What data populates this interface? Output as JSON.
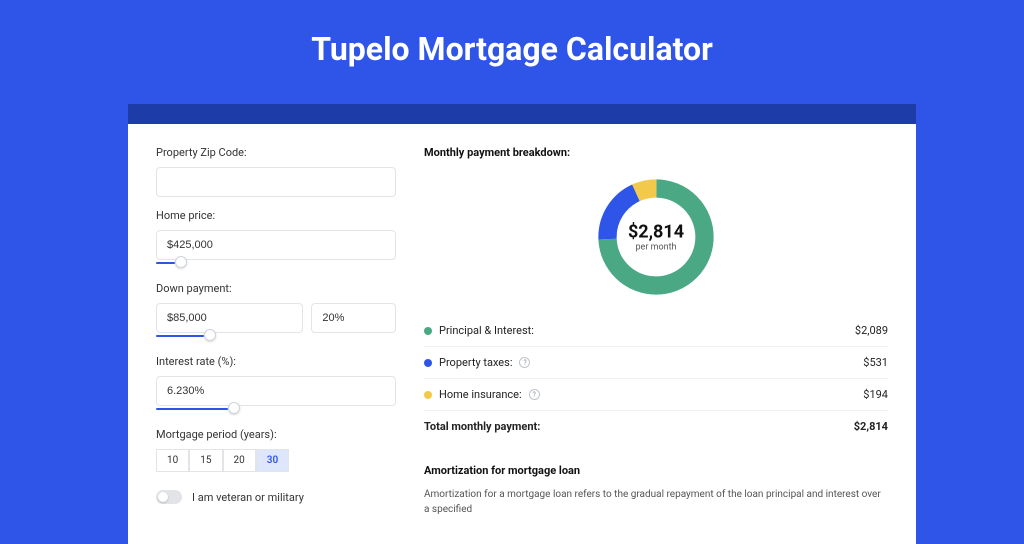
{
  "title": "Tupelo Mortgage Calculator",
  "form": {
    "zip_label": "Property Zip Code:",
    "zip_value": "",
    "price_label": "Home price:",
    "price_value": "$425,000",
    "down_label": "Down payment:",
    "down_amount": "$85,000",
    "down_pct": "20%",
    "rate_label": "Interest rate (%):",
    "rate_value": "6.230%",
    "period_label": "Mortgage period (years):",
    "periods": [
      "10",
      "15",
      "20",
      "30"
    ],
    "period_active": "30",
    "veteran_label": "I am veteran or military",
    "slider_positions": {
      "price": 8,
      "down": 20,
      "rate": 30
    }
  },
  "breakdown": {
    "title": "Monthly payment breakdown:",
    "amount": "$2,814",
    "per": "per month",
    "items": [
      {
        "label": "Principal & Interest:",
        "value": "$2,089",
        "color": "#4aa884",
        "info": false
      },
      {
        "label": "Property taxes:",
        "value": "$531",
        "color": "#2e55e8",
        "info": true
      },
      {
        "label": "Home insurance:",
        "value": "$194",
        "color": "#f3c94b",
        "info": true
      }
    ],
    "total_label": "Total monthly payment:",
    "total_value": "$2,814"
  },
  "amort": {
    "title": "Amortization for mortgage loan",
    "text": "Amortization for a mortgage loan refers to the gradual repayment of the loan principal and interest over a specified"
  },
  "chart_data": {
    "type": "pie",
    "title": "Monthly payment breakdown",
    "series": [
      {
        "name": "Principal & Interest",
        "value": 2089,
        "color": "#4aa884"
      },
      {
        "name": "Property taxes",
        "value": 531,
        "color": "#2e55e8"
      },
      {
        "name": "Home insurance",
        "value": 194,
        "color": "#f3c94b"
      }
    ],
    "total": 2814,
    "unit": "$ per month"
  }
}
